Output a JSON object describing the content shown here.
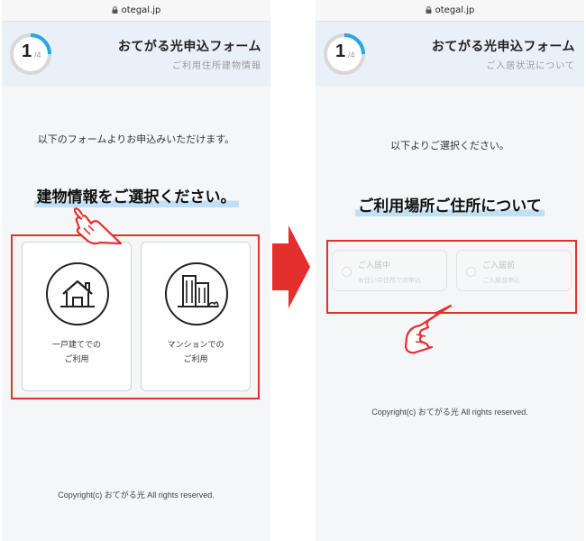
{
  "colors": {
    "accent_red": "#e52e2e",
    "progress_blue": "#2aa7e0",
    "header_bg": "#e9f0f7",
    "heading_underline": "#bfe0f5"
  },
  "left": {
    "url": "otegal.jp",
    "progress": {
      "step": "1",
      "total": "/4",
      "fraction": 0.25
    },
    "header": {
      "title": "おてがる光申込フォーム",
      "subtitle": "ご利用住所建物情報"
    },
    "intro": "以下のフォームよりお申込みいただけます。",
    "heading": "建物情報をご選択ください。",
    "options": [
      {
        "icon": "house-icon",
        "line1": "一戸建てでの",
        "line2": "ご利用"
      },
      {
        "icon": "apartment-icon",
        "line1": "マンションでの",
        "line2": "ご利用"
      }
    ],
    "copyright": "Copyright(c) おてがる光 All rights reserved."
  },
  "right": {
    "url": "otegal.jp",
    "progress": {
      "step": "1",
      "total": "/4",
      "fraction": 0.25
    },
    "header": {
      "title": "おてがる光申込フォーム",
      "subtitle": "ご入居状況について"
    },
    "intro": "以下よりご選択ください。",
    "heading": "ご利用場所ご住所について",
    "options": [
      {
        "title": "ご入居中",
        "note": "お住い中住所での申込"
      },
      {
        "title": "ご入居前",
        "note": "ご入居前申込"
      }
    ],
    "copyright": "Copyright(c) おてがる光 All rights reserved."
  }
}
